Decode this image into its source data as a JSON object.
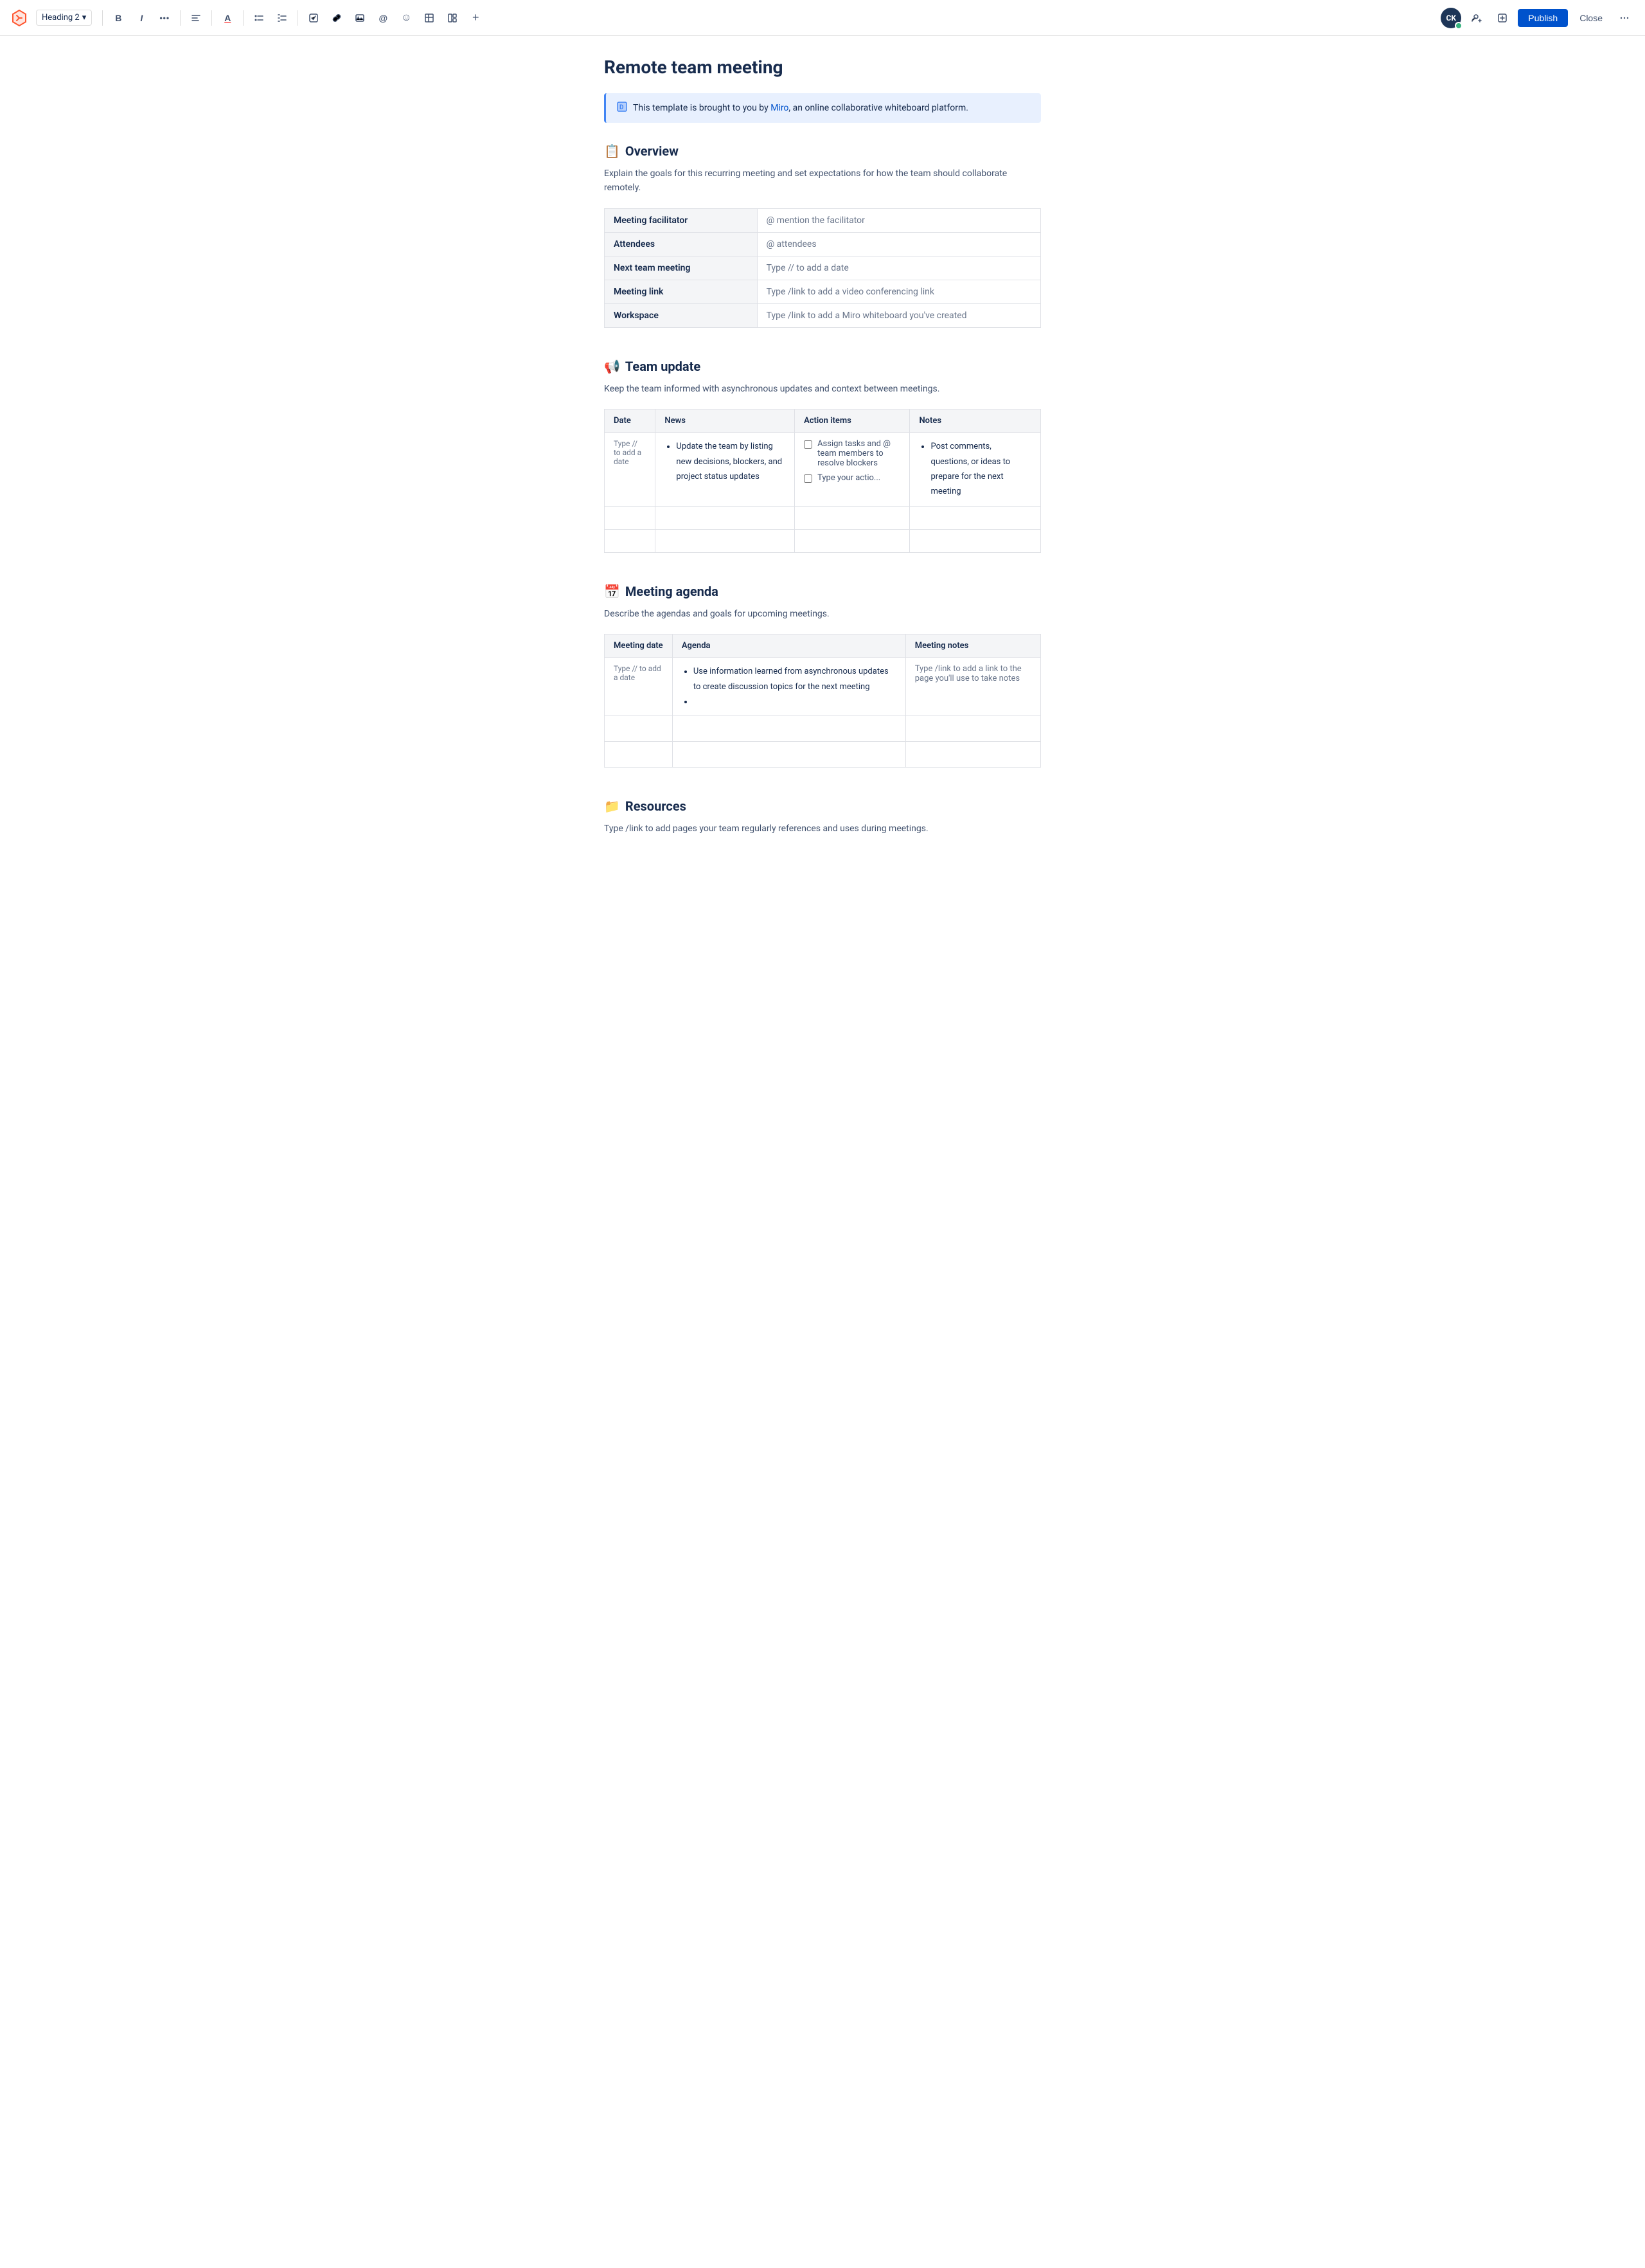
{
  "toolbar": {
    "logo_icon": "✕",
    "heading_label": "Heading 2",
    "chevron_icon": "▾",
    "bold_label": "B",
    "italic_label": "I",
    "more_icon": "•••",
    "align_icon": "≡",
    "color_icon": "A",
    "bullet_list_icon": "☰",
    "numbered_list_icon": "☰",
    "task_icon": "☑",
    "link_icon": "🔗",
    "image_icon": "🖼",
    "mention_icon": "@",
    "emoji_icon": "☺",
    "table_icon": "⊞",
    "more2_icon": "+",
    "avatar_initials": "CK",
    "add_icon": "+",
    "share_icon": "↗",
    "publish_label": "Publish",
    "close_label": "Close",
    "overflow_icon": "•••"
  },
  "page": {
    "title": "Remote team meeting"
  },
  "banner": {
    "text_before_link": "This template is brought to you by ",
    "link_text": "Miro",
    "text_after_link": ", an online collaborative whiteboard platform."
  },
  "overview": {
    "heading": "Overview",
    "icon": "📋",
    "description": "Explain the goals for this recurring meeting and set expectations for how the team should collaborate remotely.",
    "table_rows": [
      {
        "label": "Meeting facilitator",
        "value": "@ mention the facilitator"
      },
      {
        "label": "Attendees",
        "value": "@ attendees"
      },
      {
        "label": "Next team meeting",
        "value": "Type // to add a date"
      },
      {
        "label": "Meeting link",
        "value": "Type /link to add a video conferencing link"
      },
      {
        "label": "Workspace",
        "value": "Type /link to add a Miro whiteboard you've created"
      }
    ]
  },
  "team_update": {
    "heading": "Team update",
    "icon": "📢",
    "description": "Keep the team informed with asynchronous updates and context between meetings.",
    "columns": [
      "Date",
      "News",
      "Action items",
      "Notes"
    ],
    "rows": [
      {
        "date": "Type // to add a date",
        "news_items": [
          "Update the team by listing new decisions, blockers, and project status updates"
        ],
        "action_items": [
          {
            "text": "Assign tasks and @ team members to resolve blockers",
            "checked": false
          },
          {
            "text": "Type your actio...",
            "checked": false
          }
        ],
        "notes_items": [
          "Post comments, questions, or ideas to prepare for the next meeting"
        ]
      }
    ],
    "empty_rows": 2
  },
  "meeting_agenda": {
    "heading": "Meeting agenda",
    "icon": "📅",
    "description": "Describe the agendas and goals for upcoming meetings.",
    "columns": [
      "Meeting date",
      "Agenda",
      "Meeting notes"
    ],
    "rows": [
      {
        "date": "Type // to add a date",
        "agenda_items": [
          "Use information learned from asynchronous updates to create discussion topics for the next meeting",
          ""
        ],
        "notes": "Type /link to add a link to the page you'll use to take notes"
      }
    ],
    "empty_rows": 2
  },
  "resources": {
    "heading": "Resources",
    "icon": "📁",
    "description": "Type /link to add pages your team regularly references and uses during meetings."
  }
}
